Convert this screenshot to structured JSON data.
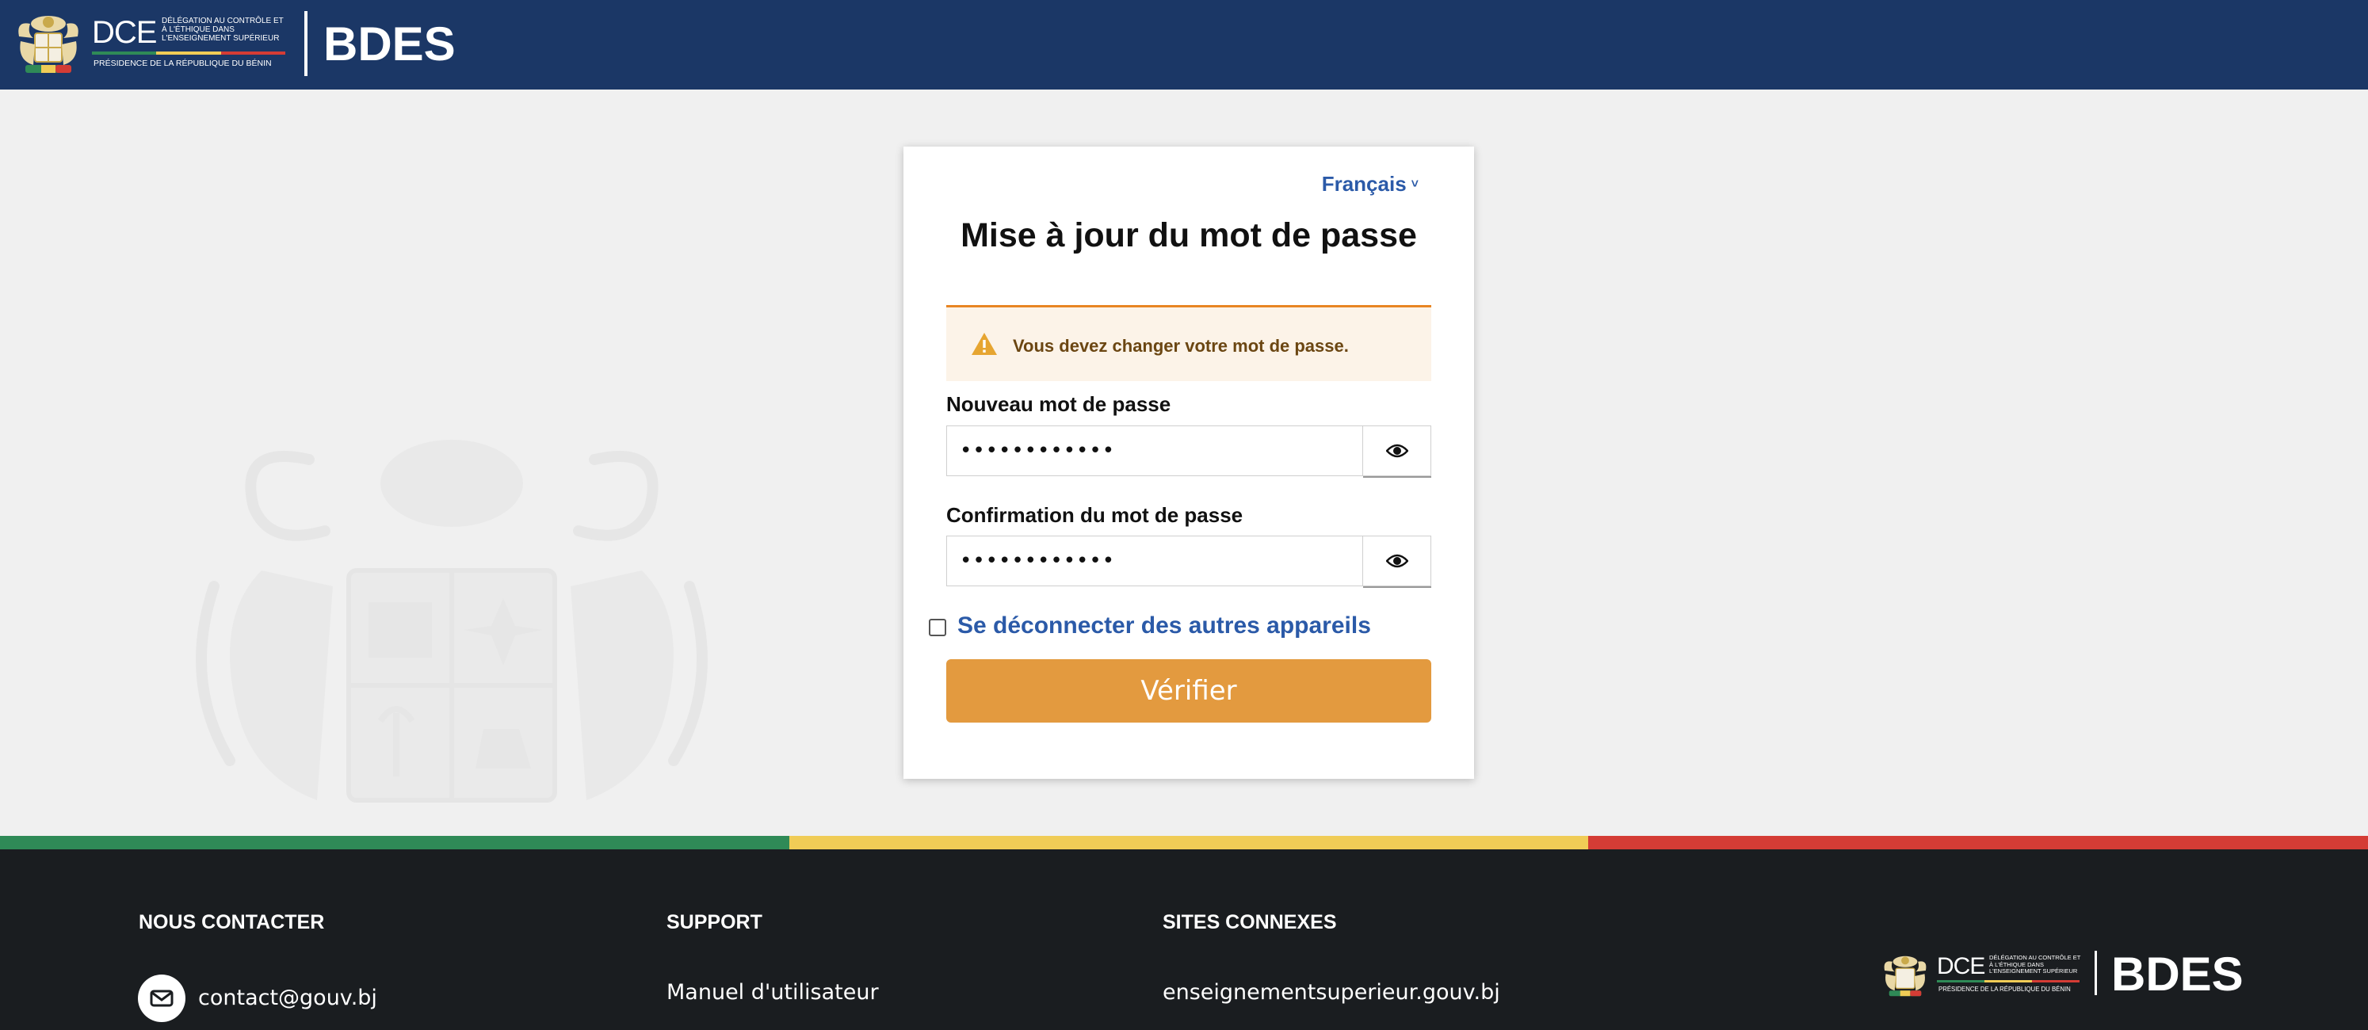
{
  "header": {
    "dce_letters": "DCE",
    "dce_description": "Délégation au contrôle et à l'éthique dans l'enseignement supérieur",
    "dce_subtitle": "Présidence de la République du Bénin",
    "brand": "BDES"
  },
  "card": {
    "language": "Français",
    "title": "Mise à jour du mot de passe",
    "alert": "Vous devez changer votre mot de passe.",
    "new_password": {
      "label": "Nouveau mot de passe",
      "value": "••••••••••••"
    },
    "confirm_password": {
      "label": "Confirmation du mot de passe",
      "value": "••••••••••••"
    },
    "logout_other_devices": "Se déconnecter des autres appareils",
    "submit": "Vérifier"
  },
  "footer": {
    "contact": {
      "heading": "NOUS CONTACTER",
      "email": "contact@gouv.bj"
    },
    "support": {
      "heading": "SUPPORT",
      "link": "Manuel d'utilisateur"
    },
    "related": {
      "heading": "SITES CONNEXES",
      "link": "enseignementsuperieur.gouv.bj"
    },
    "dce_letters": "DCE",
    "dce_description": "Délégation au contrôle et à l'éthique dans l'enseignement supérieur",
    "dce_subtitle": "Présidence de la République du Bénin",
    "brand": "BDES"
  },
  "colors": {
    "header_bg": "#1b3766",
    "accent_blue": "#2b5aa8",
    "button_orange": "#e39a3f",
    "alert_border": "#e88523",
    "flag_green": "#2f8a57",
    "flag_yellow": "#f0cc56",
    "flag_red": "#d43c35",
    "footer_bg": "#1a1d20"
  },
  "icons": {
    "coat_of_arms": "coat-of-arms-icon",
    "language_chevron": "chevron-down-icon",
    "warning": "warning-icon",
    "show_password": "eye-icon",
    "email": "envelope-icon"
  }
}
